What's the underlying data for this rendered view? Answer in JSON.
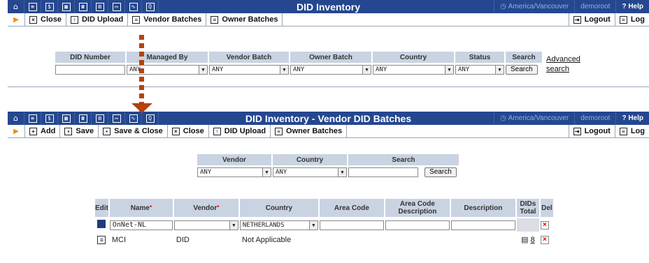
{
  "panel1": {
    "title": "DID Inventory",
    "timezone": "America/Vancouver",
    "user": "demoroot",
    "help": "Help",
    "toolbar": [
      "Close",
      "DID Upload",
      "Vendor Batches",
      "Owner Batches"
    ],
    "logout": "Logout",
    "log": "Log",
    "filter_headers": [
      "DID Number",
      "Managed By",
      "Vendor Batch",
      "Owner Batch",
      "Country",
      "Status",
      "Search"
    ],
    "managed_by": "ANY",
    "vendor_batch": "ANY",
    "owner_batch": "ANY",
    "country": "ANY",
    "status": "ANY",
    "search_button": "Search",
    "advanced_search_1": "Advanced",
    "advanced_search_2": "search"
  },
  "panel2": {
    "title": "DID Inventory - Vendor DID Batches",
    "timezone": "America/Vancouver",
    "user": "demoroot",
    "help": "Help",
    "toolbar": [
      "Add",
      "Save",
      "Save & Close",
      "Close",
      "DID Upload",
      "Owner Batches"
    ],
    "logout": "Logout",
    "log": "Log",
    "filter_headers": [
      "Vendor",
      "Country",
      "Search"
    ],
    "vendor": "ANY",
    "country": "ANY",
    "search_button": "Search",
    "columns": [
      "Edit",
      "Name",
      "Vendor",
      "Country",
      "Area Code",
      "Area Code Description",
      "Description",
      "DIDs Total",
      "Del"
    ],
    "edit_row": {
      "name": "OnNet-NL",
      "vendor": "",
      "country": "NETHERLANDS"
    },
    "rows": [
      {
        "name": "MCI",
        "vendor": "DID",
        "country": "Not Applicable",
        "dids_total": "8"
      }
    ]
  }
}
